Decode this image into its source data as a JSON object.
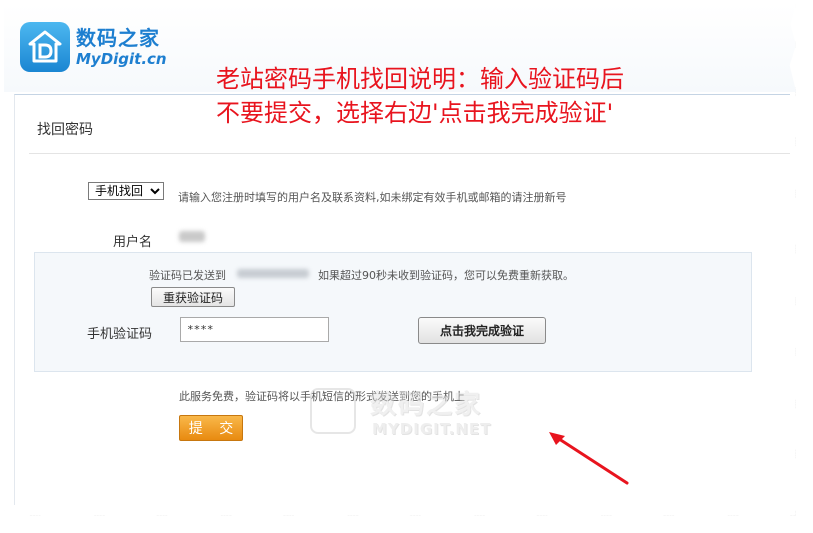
{
  "brand": {
    "name_cn": "数码之家",
    "name_en": "MyDigit.cn",
    "logo_icon": "house-d-logo-icon",
    "color": "#1e7fd0"
  },
  "annotation": {
    "line1": "老站密码手机找回说明：输入验证码后",
    "line2": "不要提交，选择右边'点击我完成验证'",
    "color": "#e8141e"
  },
  "panel": {
    "title": "找回密码",
    "method_select": {
      "selected": "手机找回",
      "options": [
        "手机找回"
      ]
    },
    "method_hint": "请输入您注册时填写的用户名及联系资料,如未绑定有效手机或邮箱的请注册新号",
    "username_label": "用户名",
    "verify": {
      "sent_prefix": "验证码已发送到",
      "sent_suffix": "如果超过90秒未收到验证码，您可以免费重新获取。",
      "resend_button": "重获验证码",
      "code_label": "手机验证码",
      "code_value": "****",
      "complete_button": "点击我完成验证"
    },
    "free_note": "此服务免费，验证码将以手机短信的形式发送到您的手机上",
    "submit_button": "提 交",
    "submit_color": "#f0a030"
  },
  "watermark": {
    "name_cn": "数码之家",
    "name_en": "MYDIGIT.NET"
  },
  "arrow_color": "#e8141e"
}
